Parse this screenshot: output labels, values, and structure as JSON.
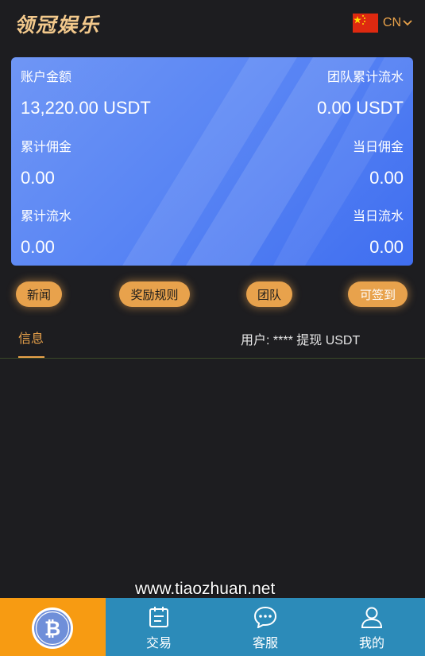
{
  "header": {
    "logo_text": "领冠娱乐",
    "language_code": "CN",
    "flag_icon": "china-flag-icon"
  },
  "account": {
    "balance_label": "账户金额",
    "balance_value": "13,220.00 USDT",
    "team_flow_label": "团队累计流水",
    "team_flow_value": "0.00 USDT",
    "total_commission_label": "累计佣金",
    "total_commission_value": "0.00",
    "daily_commission_label": "当日佣金",
    "daily_commission_value": "0.00",
    "total_flow_label": "累计流水",
    "total_flow_value": "0.00",
    "daily_flow_label": "当日流水",
    "daily_flow_value": "0.00"
  },
  "actions": {
    "news": "新闻",
    "rewards": "奖励规则",
    "team": "团队",
    "checkin": "可签到"
  },
  "info": {
    "tab_label": "信息",
    "ticker_text": "用户: **** 提现 USDT"
  },
  "watermark": "www.tiaozhuan.net",
  "tabbar": {
    "home_icon": "bitcoin-icon",
    "trade": "交易",
    "service": "客服",
    "mine": "我的"
  },
  "colors": {
    "accent": "#e9a24a",
    "tabbar": "#2c8bb9",
    "home_tab": "#f79b12"
  }
}
